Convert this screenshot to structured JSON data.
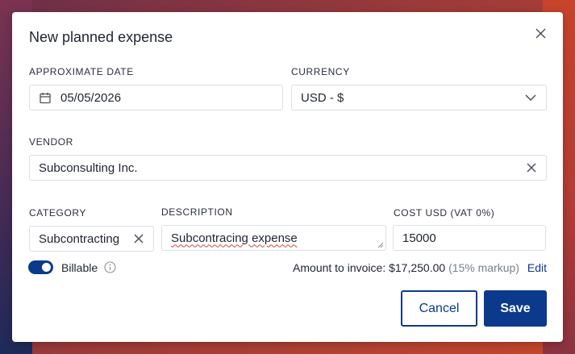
{
  "dialog": {
    "title": "New planned expense",
    "close_icon": "close-icon"
  },
  "date": {
    "label": "APPROXIMATE DATE",
    "value": "05/05/2026",
    "icon": "calendar-icon"
  },
  "currency": {
    "label": "CURRENCY",
    "value": "USD - $",
    "icon": "chevron-down-icon"
  },
  "vendor": {
    "label": "VENDOR",
    "value": "Subconsulting Inc.",
    "clear_icon": "clear-icon"
  },
  "category": {
    "label": "CATEGORY",
    "value": "Subcontracting",
    "clear_icon": "clear-icon"
  },
  "description": {
    "label": "DESCRIPTION",
    "value": "Subcontracing expense"
  },
  "cost": {
    "label": "COST USD (VAT 0%)",
    "value": "15000"
  },
  "billable": {
    "label": "Billable",
    "enabled": true,
    "info_icon": "info-icon"
  },
  "invoice": {
    "text": "Amount to invoice: $17,250.00",
    "markup": "(15% markup)",
    "edit_label": "Edit"
  },
  "actions": {
    "cancel_label": "Cancel",
    "save_label": "Save"
  },
  "colors": {
    "accent": "#0b3a8c",
    "border": "#dcdfe5",
    "text": "#1f2430",
    "muted": "#7a808c"
  }
}
